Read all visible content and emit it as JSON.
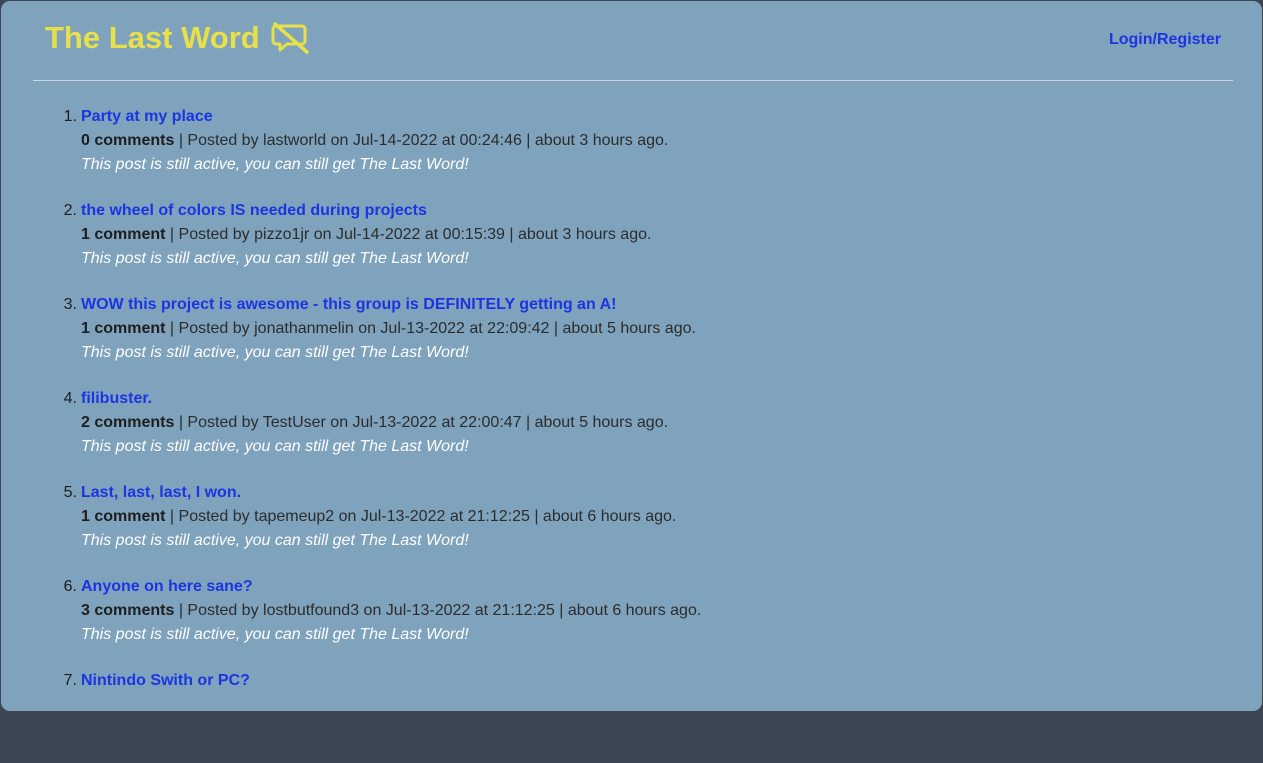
{
  "header": {
    "title": "The Last Word",
    "title_icon": "speech-bubble-off-icon",
    "login_label": "Login/Register"
  },
  "colors": {
    "background": "#7fa3bd",
    "title": "#e8e04a",
    "link": "#1b35e0",
    "status_text": "#ffffff"
  },
  "posts": [
    {
      "number": "1.",
      "title": "Party at my place",
      "comments": "0 comments",
      "meta": " | Posted by lastworld on Jul-14-2022 at 00:24:46 | about 3 hours ago.",
      "status": "This post is still active, you can still get The Last Word!"
    },
    {
      "number": "2.",
      "title": "the wheel of colors IS needed during projects",
      "comments": "1 comment",
      "meta": " | Posted by pizzo1jr on Jul-14-2022 at 00:15:39 | about 3 hours ago.",
      "status": "This post is still active, you can still get The Last Word!"
    },
    {
      "number": "3.",
      "title": "WOW this project is awesome - this group is DEFINITELY getting an A!",
      "comments": "1 comment",
      "meta": " | Posted by jonathanmelin on Jul-13-2022 at 22:09:42 | about 5 hours ago.",
      "status": "This post is still active, you can still get The Last Word!"
    },
    {
      "number": "4.",
      "title": "filibuster.",
      "comments": "2 comments",
      "meta": " | Posted by TestUser on Jul-13-2022 at 22:00:47 | about 5 hours ago.",
      "status": "This post is still active, you can still get The Last Word!"
    },
    {
      "number": "5.",
      "title": "Last, last, last, I won.",
      "comments": "1 comment",
      "meta": " | Posted by tapemeup2 on Jul-13-2022 at 21:12:25 | about 6 hours ago.",
      "status": "This post is still active, you can still get The Last Word!"
    },
    {
      "number": "6.",
      "title": "Anyone on here sane?",
      "comments": "3 comments",
      "meta": " | Posted by lostbutfound3 on Jul-13-2022 at 21:12:25 | about 6 hours ago.",
      "status": "This post is still active, you can still get The Last Word!"
    },
    {
      "number": "7.",
      "title": "Nintindo Swith or PC?"
    }
  ]
}
